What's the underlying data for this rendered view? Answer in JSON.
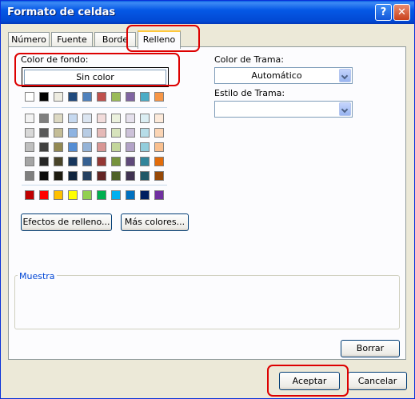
{
  "window": {
    "title": "Formato de celdas",
    "help_button": "?",
    "close_button": "✕"
  },
  "tabs": [
    {
      "label": "Número"
    },
    {
      "label": "Fuente"
    },
    {
      "label": "Borde"
    },
    {
      "label": "Relleno"
    }
  ],
  "fill": {
    "background_label": "Color de fondo:",
    "no_color_button": "Sin color",
    "effects_button": "Efectos de relleno...",
    "more_colors_button": "Más colores..."
  },
  "pattern": {
    "color_label": "Color de Trama:",
    "color_value": "Automático",
    "style_label": "Estilo de Trama:",
    "style_value": ""
  },
  "sample": {
    "label": "Muestra"
  },
  "buttons": {
    "clear": "Borrar",
    "ok": "Aceptar",
    "cancel": "Cancelar"
  },
  "palette": {
    "top_row": [
      "#ffffff",
      "#000000",
      "#eeece1",
      "#1f497d",
      "#4f81bd",
      "#c0504d",
      "#9bbb59",
      "#8064a2",
      "#4bacc6",
      "#f79646"
    ],
    "tints": [
      [
        "#f2f2f2",
        "#7f7f7f",
        "#ddd9c3",
        "#c6d9f0",
        "#dbe5f1",
        "#f2dcdb",
        "#ebf1dd",
        "#e5e0ec",
        "#dbeef3",
        "#fdeada"
      ],
      [
        "#d8d8d8",
        "#595959",
        "#c4bd97",
        "#8db3e2",
        "#b8cce4",
        "#e5b9b7",
        "#d7e3bc",
        "#ccc1d9",
        "#b7dde8",
        "#fbd5b5"
      ],
      [
        "#bfbfbf",
        "#3f3f3f",
        "#938953",
        "#548dd4",
        "#95b3d7",
        "#d99694",
        "#c3d69b",
        "#b2a2c7",
        "#92cddc",
        "#fac08f"
      ],
      [
        "#a5a5a5",
        "#262626",
        "#494429",
        "#17365d",
        "#366092",
        "#953734",
        "#76923c",
        "#5f497a",
        "#31859b",
        "#e36c09"
      ],
      [
        "#7f7f7f",
        "#0c0c0c",
        "#1d1b10",
        "#0f243e",
        "#244061",
        "#632423",
        "#4f6128",
        "#3f3151",
        "#205867",
        "#974806"
      ]
    ],
    "standard": [
      "#c00000",
      "#ff0000",
      "#ffc000",
      "#ffff00",
      "#92d050",
      "#00b050",
      "#00b0f0",
      "#0070c0",
      "#002060",
      "#7030a0"
    ]
  },
  "highlight_color": "#dd0000"
}
